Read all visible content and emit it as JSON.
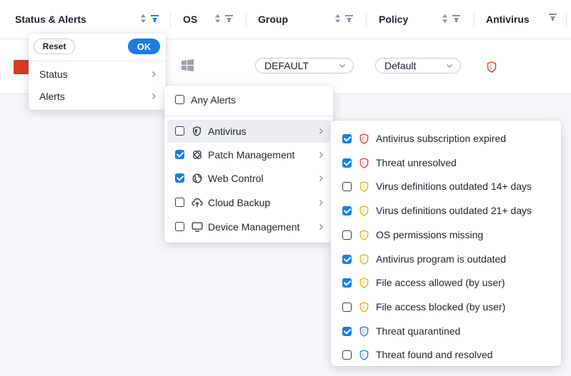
{
  "columns": {
    "status_alerts": "Status & Alerts",
    "os": "OS",
    "group": "Group",
    "policy": "Policy",
    "antivirus": "Antivirus"
  },
  "colors": {
    "accent": "#1b7ce6",
    "status_red": "#d93b1e",
    "shield_red": "#e0523a",
    "shield_amber": "#f0b429",
    "shield_blue": "#3b82f6"
  },
  "row": {
    "os_icon": "windows-icon",
    "group_value": "DEFAULT",
    "policy_value": "Default",
    "antivirus_icon": "shield-red-icon"
  },
  "filter_menu": {
    "reset_label": "Reset",
    "ok_label": "OK",
    "items": [
      {
        "label": "Status"
      },
      {
        "label": "Alerts"
      }
    ]
  },
  "alerts_menu": {
    "any_alerts": {
      "label": "Any Alerts",
      "checked": false
    },
    "items": [
      {
        "label": "Antivirus",
        "checked": false,
        "icon": "shield-icon"
      },
      {
        "label": "Patch Management",
        "checked": true,
        "icon": "patch-icon"
      },
      {
        "label": "Web Control",
        "checked": true,
        "icon": "globe-icon"
      },
      {
        "label": "Cloud Backup",
        "checked": false,
        "icon": "cloud-backup-icon"
      },
      {
        "label": "Device Management",
        "checked": false,
        "icon": "monitor-icon"
      }
    ]
  },
  "antivirus_menu": {
    "items": [
      {
        "label": "Antivirus subscription expired",
        "checked": true,
        "severity": "red"
      },
      {
        "label": "Threat unresolved",
        "checked": true,
        "severity": "red"
      },
      {
        "label": "Virus definitions outdated 14+ days",
        "checked": false,
        "severity": "amber"
      },
      {
        "label": "Virus definitions outdated 21+ days",
        "checked": true,
        "severity": "amber"
      },
      {
        "label": "OS permissions missing",
        "checked": false,
        "severity": "amber"
      },
      {
        "label": "Antivirus program is outdated",
        "checked": true,
        "severity": "amber"
      },
      {
        "label": "File access allowed (by user)",
        "checked": true,
        "severity": "amber"
      },
      {
        "label": "File access blocked (by user)",
        "checked": false,
        "severity": "amber"
      },
      {
        "label": "Threat quarantined",
        "checked": true,
        "severity": "blue"
      },
      {
        "label": "Threat found and resolved",
        "checked": false,
        "severity": "blue"
      }
    ]
  }
}
